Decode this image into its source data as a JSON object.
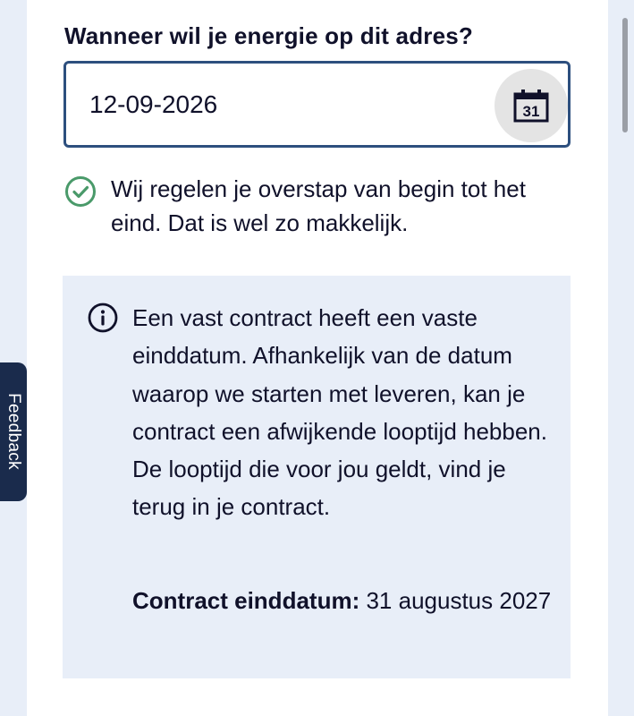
{
  "form": {
    "question_label": "Wanneer wil je energie op dit adres?",
    "start_date_value": "12-09-2026",
    "calendar_icon": "calendar-icon",
    "calendar_day": "31"
  },
  "success_message": {
    "icon": "check-circle-icon",
    "color": "#4a9a6a",
    "text": "Wij regelen je overstap van begin tot het eind. Dat is wel zo makkelijk."
  },
  "info_box": {
    "icon": "info-icon",
    "text": "Een vast contract heeft een vaste einddatum. Afhankelijk van de datum waarop we starten met leveren, kan je contract een afwijkende looptijd hebben. De looptijd die voor jou geldt, vind je terug in je contract.",
    "end_date_label": "Contract einddatum:",
    "end_date_value": "31 augustus 2027"
  },
  "feedback_tab": {
    "label": "Feedback"
  },
  "colors": {
    "field_border": "#2d4f7e",
    "info_bg": "#e8eef8",
    "feedback_bg": "#1a2b4c"
  }
}
